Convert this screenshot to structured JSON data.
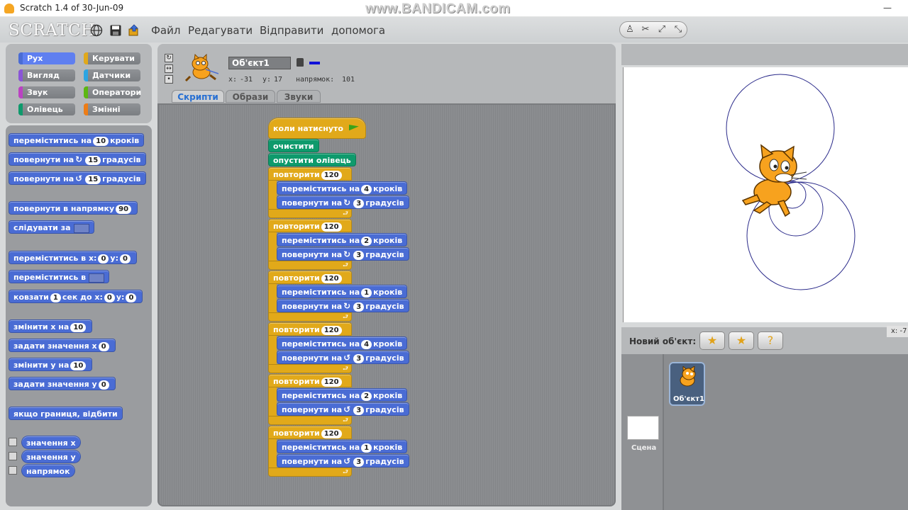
{
  "window": {
    "title": "Scratch 1.4 of 30-Jun-09",
    "watermark": "www.BANDICAM.com"
  },
  "menubar": {
    "logo": "SCRATCH",
    "items": [
      "Файл",
      "Редагувати",
      "Відправити",
      "допомога"
    ]
  },
  "categories": [
    {
      "label": "Рух",
      "color": "#4a6cd4"
    },
    {
      "label": "Керувати",
      "color": "#e1a91a"
    },
    {
      "label": "Вигляд",
      "color": "#8a55d7"
    },
    {
      "label": "Датчики",
      "color": "#2ca5e2"
    },
    {
      "label": "Звук",
      "color": "#bb42c3"
    },
    {
      "label": "Оператори",
      "color": "#5cb712"
    },
    {
      "label": "Олівець",
      "color": "#0e9a6c"
    },
    {
      "label": "Змінні",
      "color": "#ee7d16"
    }
  ],
  "palette": {
    "move": {
      "label": "переміститись на",
      "value": "10",
      "suffix": "кроків"
    },
    "turn_cw": {
      "label": "повернути на",
      "value": "15",
      "suffix": "градусів"
    },
    "turn_ccw": {
      "label": "повернути на",
      "value": "15",
      "suffix": "градусів"
    },
    "point_dir": {
      "label": "повернути в напрямку",
      "value": "90"
    },
    "point_towards": {
      "label": "слідувати за"
    },
    "goto_xy": {
      "label": "переміститись в x:",
      "x": "0",
      "ylabel": "y:",
      "y": "0"
    },
    "goto": {
      "label": "переміститись в"
    },
    "glide": {
      "label": "ковзати",
      "secs": "1",
      "mid": "сек до x:",
      "x": "0",
      "ylabel": "y:",
      "y": "0"
    },
    "change_x": {
      "label": "змінити x на",
      "value": "10"
    },
    "set_x": {
      "label": "задати значення x",
      "value": "0"
    },
    "change_y": {
      "label": "змінити y на",
      "value": "10"
    },
    "set_y": {
      "label": "задати значення y",
      "value": "0"
    },
    "bounce": {
      "label": "якщо границя, відбити"
    },
    "reporters": [
      "значення x",
      "значення y",
      "напрямок"
    ]
  },
  "sprite": {
    "name": "Об'єкт1",
    "x_label": "x:",
    "x": "-31",
    "y_label": "y:",
    "y": "17",
    "dir_label": "напрямок:",
    "dir": "101"
  },
  "tabs": [
    "Скрипти",
    "Образи",
    "Звуки"
  ],
  "script": {
    "hat": "коли натиснуто",
    "clear": "очистити",
    "pen_down": "опустити олівець",
    "repeat_label": "повторити",
    "move_label": "переміститись на",
    "steps_label": "кроків",
    "turn_label": "повернути на",
    "degrees_label": "градусів",
    "loops": [
      {
        "times": "120",
        "steps": "4",
        "degrees": "3",
        "turn": "cw"
      },
      {
        "times": "120",
        "steps": "2",
        "degrees": "3",
        "turn": "cw"
      },
      {
        "times": "120",
        "steps": "1",
        "degrees": "3",
        "turn": "cw"
      },
      {
        "times": "120",
        "steps": "4",
        "degrees": "3",
        "turn": "ccw"
      },
      {
        "times": "120",
        "steps": "2",
        "degrees": "3",
        "turn": "ccw"
      },
      {
        "times": "120",
        "steps": "1",
        "degrees": "3",
        "turn": "ccw"
      }
    ]
  },
  "stage": {
    "new_sprite_label": "Новий об'єкт:",
    "xy_readout": "x: -7",
    "stage_label": "Сцена",
    "sprite_label": "Об'єкт1"
  },
  "colors": {
    "motion": "#4a6cd4",
    "control": "#e1a91a",
    "pen": "#0e9a6c",
    "pen_trace": "#2a2a8a"
  }
}
